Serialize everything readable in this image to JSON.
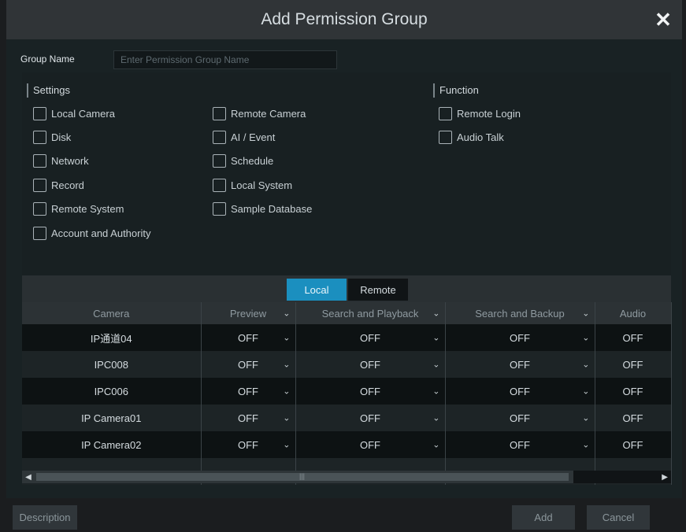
{
  "dialog": {
    "title": "Add Permission Group"
  },
  "group_name": {
    "label": "Group Name",
    "placeholder": "Enter Permission Group Name",
    "value": ""
  },
  "settings": {
    "title": "Settings",
    "col1": [
      "Local Camera",
      "Disk",
      "Network",
      "Record",
      "Remote System",
      "Account and Authority"
    ],
    "col2": [
      "Remote Camera",
      "AI / Event",
      "Schedule",
      "Local System",
      "Sample Database"
    ]
  },
  "function": {
    "title": "Function",
    "items": [
      "Remote Login",
      "Audio Talk"
    ]
  },
  "tabs": [
    {
      "label": "Local"
    },
    {
      "label": "Remote"
    }
  ],
  "table": {
    "headers": [
      "Camera",
      "Preview",
      "Search and Playback",
      "Search and Backup",
      "Audio"
    ],
    "rows": [
      {
        "camera": "IP通道04",
        "preview": "OFF",
        "search_playback": "OFF",
        "search_backup": "OFF",
        "audio": "OFF"
      },
      {
        "camera": "IPC008",
        "preview": "OFF",
        "search_playback": "OFF",
        "search_backup": "OFF",
        "audio": "OFF"
      },
      {
        "camera": "IPC006",
        "preview": "OFF",
        "search_playback": "OFF",
        "search_backup": "OFF",
        "audio": "OFF"
      },
      {
        "camera": "IP Camera01",
        "preview": "OFF",
        "search_playback": "OFF",
        "search_backup": "OFF",
        "audio": "OFF"
      },
      {
        "camera": "IP Camera02",
        "preview": "OFF",
        "search_playback": "OFF",
        "search_backup": "OFF",
        "audio": "OFF"
      }
    ]
  },
  "footer": {
    "description": "Description",
    "add": "Add",
    "cancel": "Cancel"
  },
  "colors": {
    "accent": "#1b8fbf",
    "panel": "#192224",
    "titlebar": "#303437"
  }
}
